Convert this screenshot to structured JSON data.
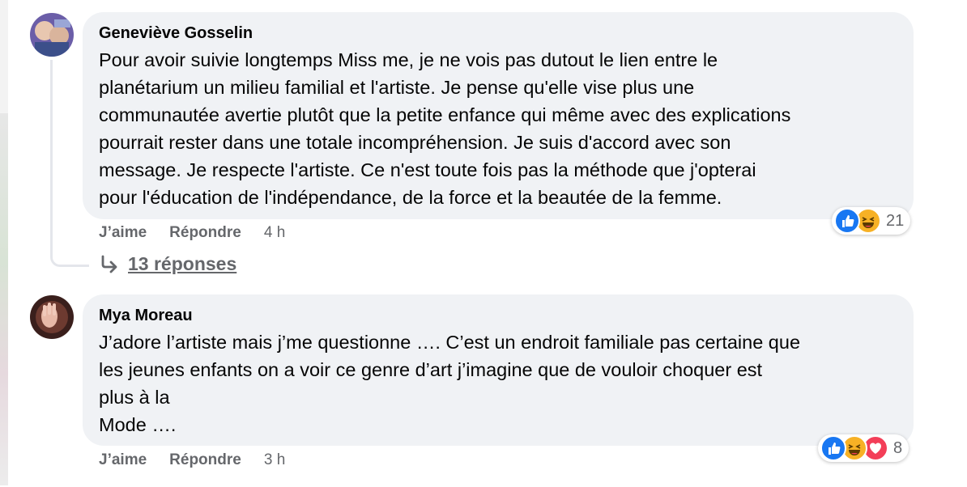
{
  "comments": [
    {
      "author": "Geneviève Gosselin",
      "text": "Pour avoir suivie longtemps Miss me, je ne vois pas dutout le lien entre le\nplanétarium un milieu familial et l'artiste. Je pense qu'elle vise plus une\ncommunautée avertie plutôt que la petite enfance qui même avec des explications\npourrait rester dans une totale incompréhension. Je suis d'accord avec son\nmessage. Je respecte l'artiste. Ce n'est toute fois pas la méthode que j'opterai\npour l'éducation de l'indépendance, de la force et la beautée de la femme.",
      "like_label": "J’aime",
      "reply_label": "Répondre",
      "time": "4 h",
      "reaction_count": "21",
      "reaction_icons": [
        "like-icon",
        "haha-icon"
      ],
      "replies_label": "13 réponses"
    },
    {
      "author": "Mya Moreau",
      "text": "J’adore l’artiste mais j’me questionne …. C’est un endroit familiale pas certaine que\nles jeunes enfants on a voir ce genre d’art j’imagine que de vouloir choquer est\nplus à la\nMode ….",
      "like_label": "J’aime",
      "reply_label": "Répondre",
      "time": "3 h",
      "reaction_count": "8",
      "reaction_icons": [
        "like-icon",
        "haha-icon",
        "love-icon"
      ]
    }
  ],
  "colors": {
    "bubble": "#f0f2f5",
    "meta_text": "#65676b",
    "like_blue": "#1877f2",
    "haha_yellow": "#f7b125",
    "love_red": "#f33e58"
  }
}
